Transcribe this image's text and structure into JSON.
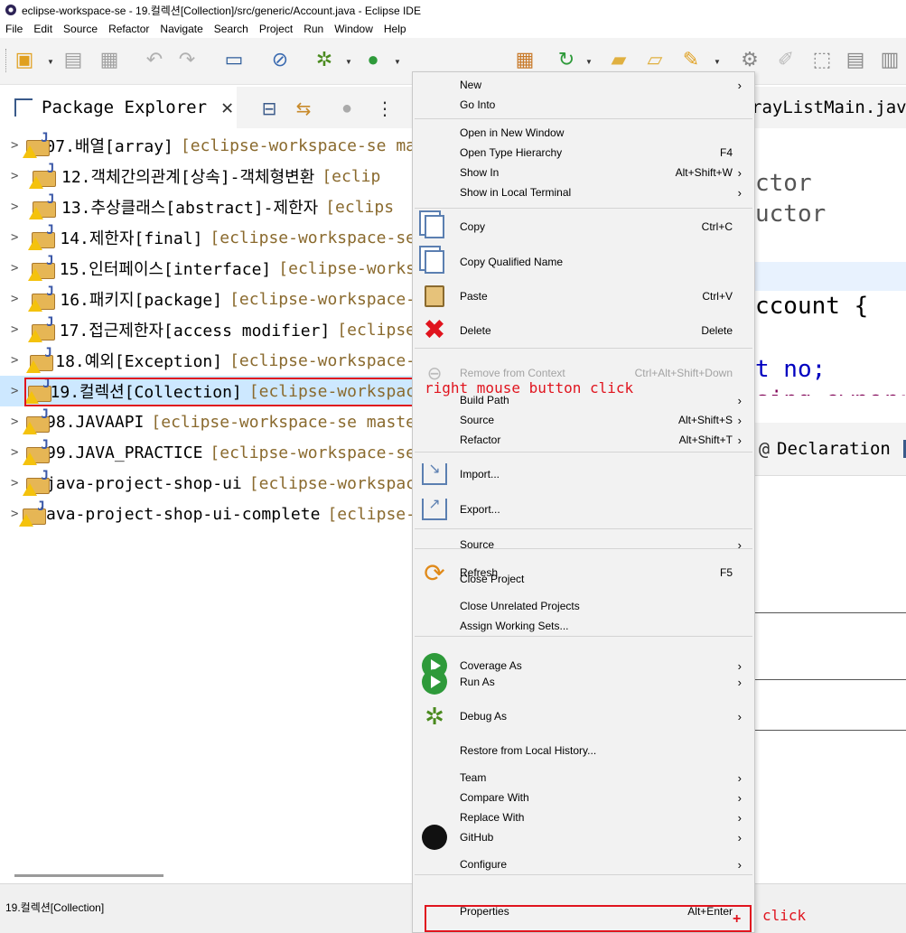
{
  "window": {
    "title": "eclipse-workspace-se - 19.컬렉션[Collection]/src/generic/Account.java - Eclipse IDE"
  },
  "menubar": [
    "File",
    "Edit",
    "Source",
    "Refactor",
    "Navigate",
    "Search",
    "Project",
    "Run",
    "Window",
    "Help"
  ],
  "package_explorer": {
    "title": "Package Explorer",
    "projects": [
      {
        "name": "07.배열[array]",
        "repo": "[eclipse-workspace-se ma"
      },
      {
        "name": "12.객체간의관계[상속]-객체형변환",
        "repo": "[eclip"
      },
      {
        "name": "13.추상클래스[abstract]-제한자",
        "repo": "[eclips"
      },
      {
        "name": "14.제한자[final]",
        "repo": "[eclipse-workspace-se"
      },
      {
        "name": "15.인터페이스[interface]",
        "repo": "[eclipse-works"
      },
      {
        "name": "16.패키지[package]",
        "repo": "[eclipse-workspace-"
      },
      {
        "name": "17.접근제한자[access modifier]",
        "repo": "[eclipse"
      },
      {
        "name": "18.예외[Exception]",
        "repo": "[eclipse-workspace-"
      },
      {
        "name": "19.컬렉션[Collection]",
        "repo": "[eclipse-workspac",
        "selected": true
      },
      {
        "name": "98.JAVAAPI",
        "repo": "[eclipse-workspace-se maste"
      },
      {
        "name": "99.JAVA_PRACTICE",
        "repo": "[eclipse-workspace-se"
      },
      {
        "name": "java-project-shop-ui",
        "repo": "[eclipse-workspac"
      },
      {
        "name": "java-project-shop-ui-complete",
        "repo": "[eclipse-"
      }
    ]
  },
  "editor": {
    "tab_label": "rayListMain.java",
    "code_lines": [
      "ctor",
      "uctor",
      "",
      "ccount {",
      "t no;",
      "sing owner;"
    ],
    "declaration_label": "Declaration"
  },
  "context_menu": {
    "items": [
      {
        "label": "New",
        "submenu": true
      },
      {
        "label": "Go Into"
      },
      {
        "sep": true
      },
      {
        "label": "Open in New Window"
      },
      {
        "label": "Open Type Hierarchy",
        "shortcut": "F4"
      },
      {
        "label": "Show In",
        "shortcut": "Alt+Shift+W",
        "submenu": true
      },
      {
        "label": "Show in Local Terminal",
        "submenu": true
      },
      {
        "sep": true
      },
      {
        "label": "Copy",
        "shortcut": "Ctrl+C",
        "icon": "copy-icon"
      },
      {
        "label": "Copy Qualified Name",
        "icon": "copy-qualified-name-icon"
      },
      {
        "label": "Paste",
        "shortcut": "Ctrl+V",
        "icon": "paste-icon"
      },
      {
        "label": "Delete",
        "shortcut": "Delete",
        "icon": "delete-icon"
      },
      {
        "sep": true
      },
      {
        "label": "Remove from Context",
        "shortcut": "Ctrl+Alt+Shift+Down",
        "disabled": true,
        "icon": "remove-context-icon"
      },
      {
        "label": "Build Path",
        "submenu": true
      },
      {
        "label": "Source",
        "shortcut": "Alt+Shift+S",
        "submenu": true
      },
      {
        "label": "Refactor",
        "shortcut": "Alt+Shift+T",
        "submenu": true
      },
      {
        "sep": true
      },
      {
        "label": "Import...",
        "icon": "import-icon"
      },
      {
        "label": "Export...",
        "icon": "export-icon"
      },
      {
        "sep": true
      },
      {
        "label": "Source",
        "submenu": true
      },
      {
        "sep": true
      },
      {
        "label": "Refresh",
        "shortcut": "F5",
        "icon": "refresh-icon"
      },
      {
        "label": "Close Project"
      },
      {
        "label": "Close Unrelated Projects"
      },
      {
        "label": "Assign Working Sets..."
      },
      {
        "sep": true
      },
      {
        "label": "Coverage As",
        "submenu": true,
        "icon": "coverage-icon"
      },
      {
        "label": "Run As",
        "submenu": true,
        "icon": "run-icon"
      },
      {
        "label": "Debug As",
        "submenu": true,
        "icon": "debug-icon"
      },
      {
        "label": "Restore from Local History..."
      },
      {
        "label": "Team",
        "submenu": true
      },
      {
        "label": "Compare With",
        "submenu": true
      },
      {
        "label": "Replace With",
        "submenu": true
      },
      {
        "label": "GitHub",
        "submenu": true,
        "icon": "github-icon"
      },
      {
        "label": "Configure",
        "submenu": true
      },
      {
        "sep": true
      },
      {
        "label": "Properties",
        "shortcut": "Alt+Enter"
      }
    ]
  },
  "annotations": {
    "right_click": "right mouse button click",
    "click": "click",
    "plus": "+"
  },
  "status": {
    "text": "19.컬렉션[Collection]"
  },
  "colors": {
    "annotation": "#e0141e",
    "selection": "#cde8ff",
    "repo_text": "#8a6a2e"
  }
}
